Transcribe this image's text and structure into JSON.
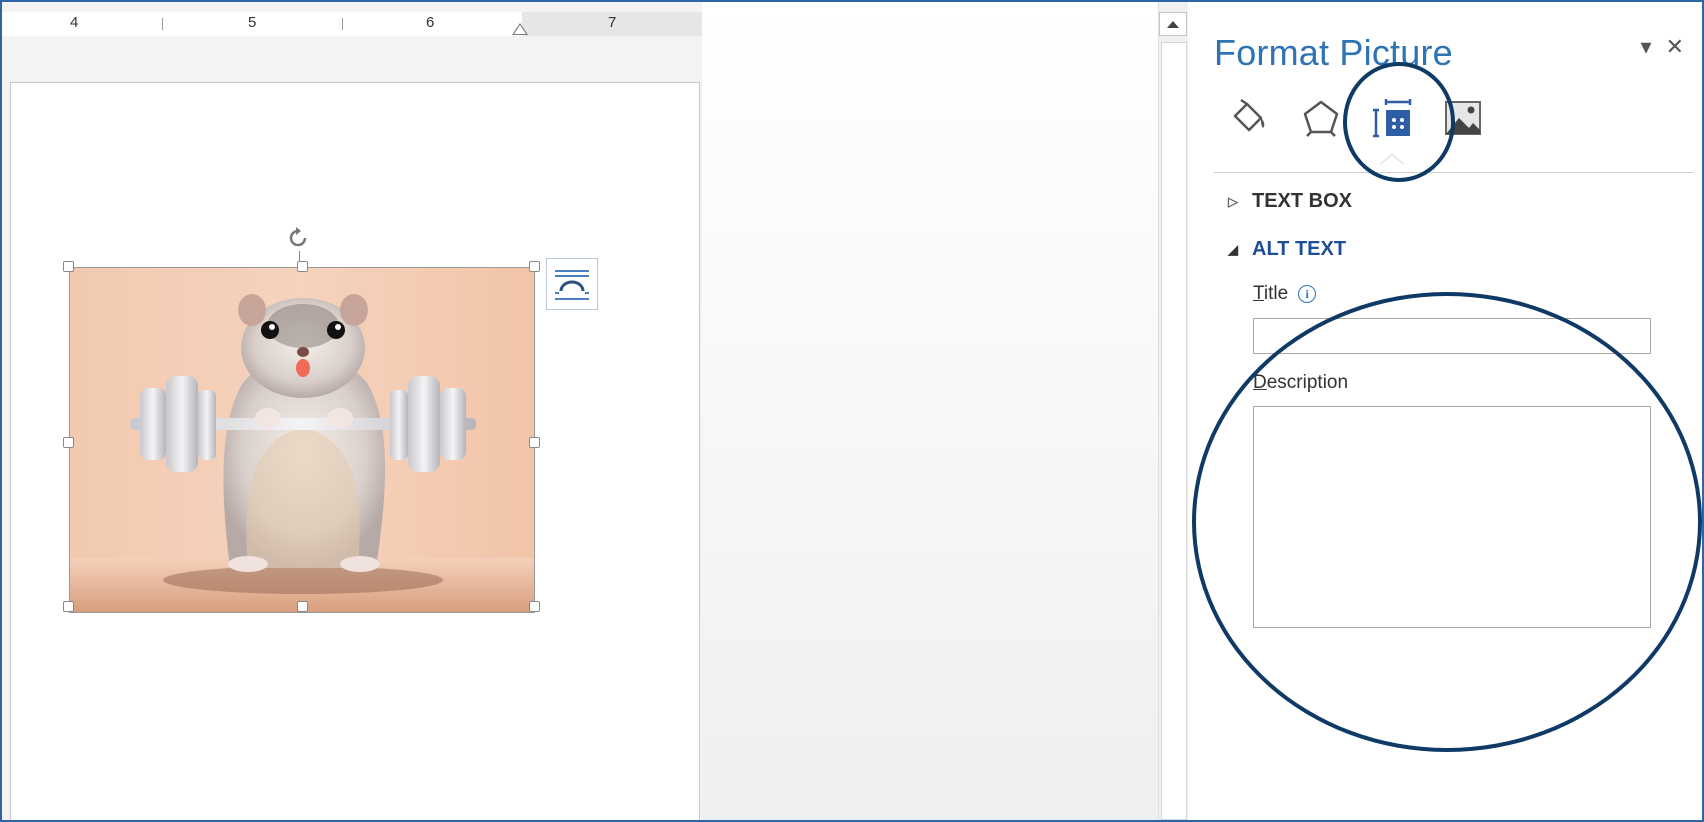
{
  "ruler": {
    "numbers": [
      "4",
      "5",
      "6",
      "7"
    ]
  },
  "document": {
    "picture": {
      "description": "hamster lifting barbell",
      "icon": "hamster-picture"
    },
    "layout_options_icon": "layout-options-icon",
    "rotate_icon": "rotate-handle-icon"
  },
  "scrollbar": {
    "up_icon": "triangle-up-icon"
  },
  "pane": {
    "title": "Format Picture",
    "controls": {
      "options_icon": "▾",
      "close_icon": "✕"
    },
    "tabs": [
      {
        "name": "fill-line",
        "icon": "paint-bucket-icon"
      },
      {
        "name": "effects",
        "icon": "pentagon-icon"
      },
      {
        "name": "layout-properties",
        "icon": "size-layout-icon",
        "selected": true
      },
      {
        "name": "picture",
        "icon": "picture-icon"
      }
    ],
    "sections": {
      "text_box": {
        "label": "TEXT BOX",
        "expanded": false,
        "caret": "▷"
      },
      "alt_text": {
        "label": "ALT TEXT",
        "expanded": true,
        "caret": "◢"
      }
    },
    "alt_text": {
      "title_label_first": "T",
      "title_label_rest": "itle",
      "title_info_icon": "i",
      "title_value": "",
      "description_label_first": "D",
      "description_label_rest": "escription",
      "description_value": ""
    }
  },
  "colors": {
    "accent": "#2e74b5",
    "alt_text_heading": "#1f4e99",
    "highlight_circle": "#0f3a66",
    "frame": "#2f64a6"
  }
}
